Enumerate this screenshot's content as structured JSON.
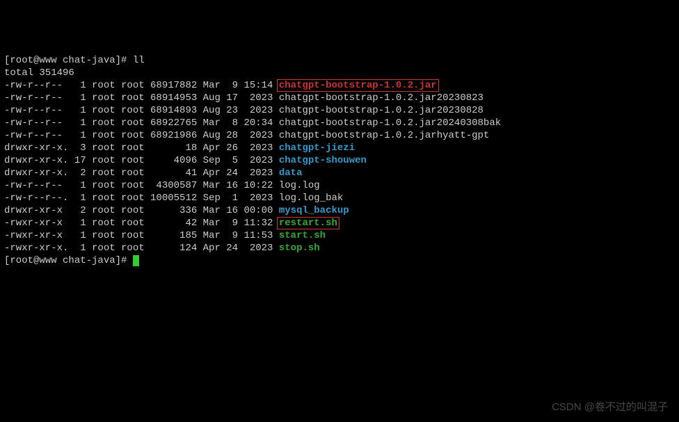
{
  "prompt1": "[root@www chat-java]# ",
  "command1": "ll",
  "total_line": "total 351496",
  "entries": [
    {
      "perm": "-rw-r--r--   1 root root 68917882 Mar  9 15:14 ",
      "name": "chatgpt-bootstrap-1.0.2.jar",
      "cls": "file-bold-red",
      "boxed": true
    },
    {
      "perm": "-rw-r--r--   1 root root 68914953 Aug 17  2023 ",
      "name": "chatgpt-bootstrap-1.0.2.jar20230823",
      "cls": "file-white"
    },
    {
      "perm": "-rw-r--r--   1 root root 68914893 Aug 23  2023 ",
      "name": "chatgpt-bootstrap-1.0.2.jar20230828",
      "cls": "file-white"
    },
    {
      "perm": "-rw-r--r--   1 root root 68922765 Mar  8 20:34 ",
      "name": "chatgpt-bootstrap-1.0.2.jar20240308bak",
      "cls": "file-white"
    },
    {
      "perm": "-rw-r--r--   1 root root 68921986 Aug 28  2023 ",
      "name": "chatgpt-bootstrap-1.0.2.jarhyatt-gpt",
      "cls": "file-white"
    },
    {
      "perm": "drwxr-xr-x.  3 root root       18 Apr 26  2023 ",
      "name": "chatgpt-jiezi",
      "cls": "file-cyan"
    },
    {
      "perm": "drwxr-xr-x. 17 root root     4096 Sep  5  2023 ",
      "name": "chatgpt-shouwen",
      "cls": "file-cyan"
    },
    {
      "perm": "drwxr-xr-x.  2 root root       41 Apr 24  2023 ",
      "name": "data",
      "cls": "file-cyan"
    },
    {
      "perm": "-rw-r--r--   1 root root  4300587 Mar 16 10:22 ",
      "name": "log.log",
      "cls": "file-white"
    },
    {
      "perm": "-rw-r--r--.  1 root root 10005512 Sep  1  2023 ",
      "name": "log.log_bak",
      "cls": "file-white"
    },
    {
      "perm": "drwxr-xr-x   2 root root      336 Mar 16 00:00 ",
      "name": "mysql_backup",
      "cls": "file-cyan"
    },
    {
      "perm": "-rwxr-xr-x   1 root root       42 Mar  9 11:32 ",
      "name": "restart.sh",
      "cls": "file-green",
      "boxed": true
    },
    {
      "perm": "-rwxr-xr-x   1 root root      185 Mar  9 11:53 ",
      "name": "start.sh",
      "cls": "file-green"
    },
    {
      "perm": "-rwxr-xr-x.  1 root root      124 Apr 24  2023 ",
      "name": "stop.sh",
      "cls": "file-green"
    }
  ],
  "prompt2": "[root@www chat-java]# ",
  "watermark": "CSDN @卷不过的叫混子"
}
